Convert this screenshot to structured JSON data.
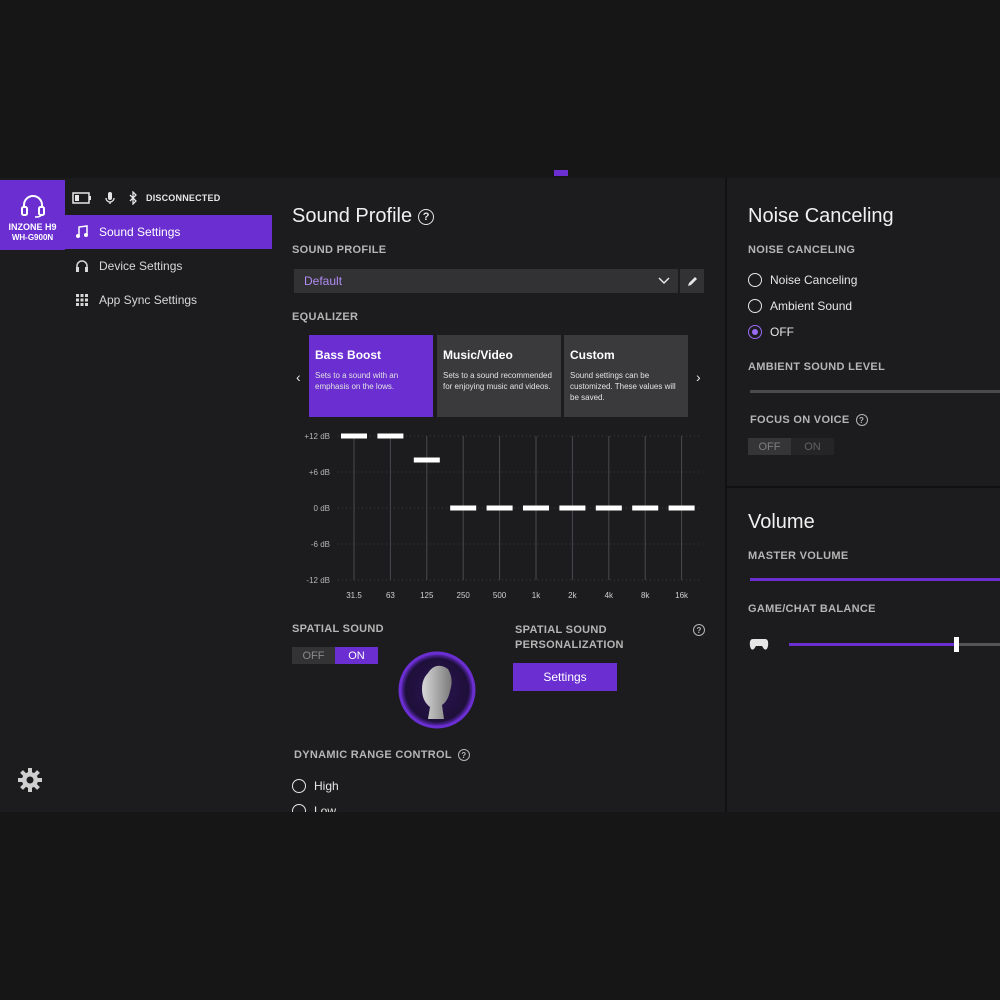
{
  "device": {
    "name_line1": "INZONE H9",
    "name_line2": "WH-G900N"
  },
  "status": {
    "connection": "DISCONNECTED"
  },
  "sidebar": {
    "items": [
      {
        "label": "Sound Settings",
        "icon": "music-note-icon",
        "active": true
      },
      {
        "label": "Device Settings",
        "icon": "headphones-icon",
        "active": false
      },
      {
        "label": "App Sync Settings",
        "icon": "grid-icon",
        "active": false
      }
    ]
  },
  "sound_profile": {
    "title": "Sound Profile",
    "label": "SOUND PROFILE",
    "selected": "Default"
  },
  "equalizer": {
    "label": "EQUALIZER",
    "presets": [
      {
        "title": "Bass Boost",
        "desc": "Sets to a sound with an emphasis on the lows.",
        "active": true
      },
      {
        "title": "Music/Video",
        "desc": "Sets to a sound recommended for enjoying music and videos.",
        "active": false
      },
      {
        "title": "Custom",
        "desc": "Sound settings can be customized. These values will be saved.",
        "active": false
      }
    ]
  },
  "chart_data": {
    "type": "bar",
    "categories": [
      "31.5",
      "63",
      "125",
      "250",
      "500",
      "1k",
      "2k",
      "4k",
      "8k",
      "16k"
    ],
    "values": [
      12,
      12,
      8,
      0,
      0,
      0,
      0,
      0,
      0,
      0
    ],
    "ylim": [
      -12,
      12
    ],
    "yticks": [
      "+12 dB",
      "+6 dB",
      "0 dB",
      "-6 dB",
      "-12 dB"
    ],
    "ytick_values": [
      12,
      6,
      0,
      -6,
      -12
    ],
    "colors": {
      "bar": "#ffffff",
      "grid": "#3a3a3d"
    }
  },
  "spatial_sound": {
    "label": "SPATIAL SOUND",
    "toggle": {
      "off": "OFF",
      "on": "ON",
      "state": "on"
    },
    "personalization_label_1": "SPATIAL SOUND",
    "personalization_label_2": "PERSONALIZATION",
    "settings_button": "Settings"
  },
  "dynamic_range": {
    "label": "DYNAMIC RANGE CONTROL",
    "options": [
      {
        "label": "High",
        "selected": false
      },
      {
        "label": "Low",
        "selected": false
      }
    ]
  },
  "noise_canceling": {
    "title": "Noise Canceling",
    "label": "NOISE CANCELING",
    "options": [
      {
        "label": "Noise Canceling",
        "selected": false
      },
      {
        "label": "Ambient Sound",
        "selected": false
      },
      {
        "label": "OFF",
        "selected": true
      }
    ],
    "ambient_label": "AMBIENT SOUND LEVEL",
    "focus_label": "FOCUS ON VOICE",
    "focus_toggle": {
      "off": "OFF",
      "on": "ON",
      "state": "off"
    }
  },
  "volume": {
    "title": "Volume",
    "master_label": "MASTER VOLUME",
    "balance_label": "GAME/CHAT BALANCE",
    "balance_level": 0.79
  },
  "theme": {
    "accent": "#6a2ed1",
    "panel": "#1c1c1e"
  }
}
